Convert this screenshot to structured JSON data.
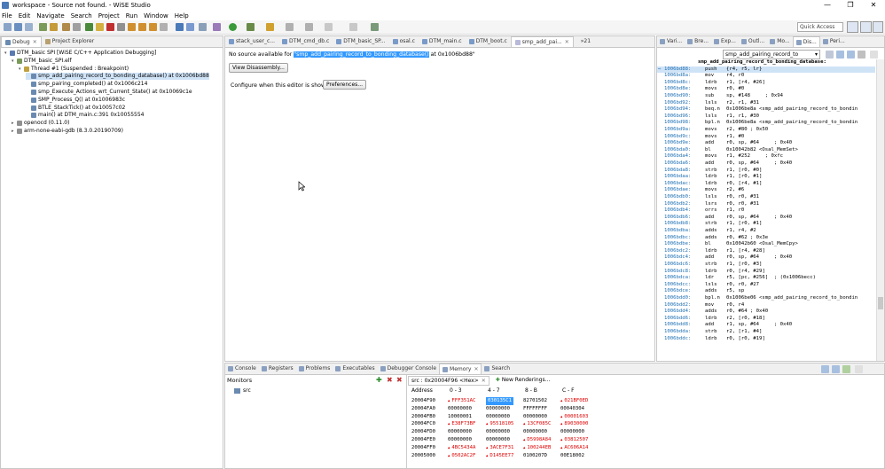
{
  "window": {
    "title": "workspace - Source not found. - WiSE Studio",
    "controls": [
      "—",
      "❐",
      "✕"
    ]
  },
  "menu": [
    "File",
    "Edit",
    "Navigate",
    "Search",
    "Project",
    "Run",
    "Window",
    "Help"
  ],
  "quick_access": {
    "placeholder": "Quick Access"
  },
  "debug_view": {
    "tabs": [
      {
        "label": "Debug",
        "active": true
      },
      {
        "label": "Project Explorer",
        "active": false
      }
    ],
    "tree": [
      {
        "label": "DTM_basic SPI [WiSE C/C++ Application Debugging]",
        "indent": 0,
        "icon": "launch-icon",
        "expanded": true,
        "selected": false
      },
      {
        "label": "DTM_basic_SPI.elf",
        "indent": 1,
        "icon": "elf-icon",
        "expanded": true,
        "selected": false
      },
      {
        "label": "Thread #1 (Suspended : Breakpoint)",
        "indent": 2,
        "icon": "thread-icon",
        "expanded": true,
        "selected": false
      },
      {
        "label": "smp_add_pairing_record_to_bonding_database() at 0x1006bd88",
        "indent": 3,
        "icon": "frame-icon",
        "expanded": false,
        "selected": true
      },
      {
        "label": "smp_pairing_completed() at 0x1006c214",
        "indent": 3,
        "icon": "frame-icon",
        "expanded": false,
        "selected": false
      },
      {
        "label": "smp_Execute_Actions_wrt_Current_State() at 0x10069c1e",
        "indent": 3,
        "icon": "frame-icon",
        "expanded": false,
        "selected": false
      },
      {
        "label": "SMP_Process_Q() at 0x1006983c",
        "indent": 3,
        "icon": "frame-icon",
        "expanded": false,
        "selected": false
      },
      {
        "label": "BTLE_StackTick() at 0x10057c02",
        "indent": 3,
        "icon": "frame-icon",
        "expanded": false,
        "selected": false
      },
      {
        "label": "main() at DTM_main.c:391 0x10055554",
        "indent": 3,
        "icon": "frame-icon",
        "expanded": false,
        "selected": false
      },
      {
        "label": "openocd (0.11.0)",
        "indent": 1,
        "icon": "process-icon",
        "expanded": false,
        "selected": false
      },
      {
        "label": "arm-none-eabi-gdb (8.3.0.20190709)",
        "indent": 1,
        "icon": "process-icon",
        "expanded": false,
        "selected": false
      }
    ]
  },
  "editor": {
    "tabs": [
      {
        "label": "stack_user_c...",
        "active": false
      },
      {
        "label": "DTM_cmd_db.c",
        "active": false
      },
      {
        "label": "DTM_basic_SP...",
        "active": false
      },
      {
        "label": "osal.c",
        "active": false
      },
      {
        "label": "DTM_main.c",
        "active": false
      },
      {
        "label": "DTM_boot.c",
        "active": false
      },
      {
        "label": "smp_add_pai...",
        "active": true
      }
    ],
    "overflow": "»21",
    "msg_prefix": "No source available for ",
    "msg_func": "\"smp_add_pairing_record_to_bonding_database()",
    "msg_suffix": " at 0x1006bd88\"",
    "view_disassembly_label": "View Disassembly...",
    "configure_text": "Configure when this editor is shown",
    "preferences_label": "Preferences..."
  },
  "right_tabs": [
    "Vari...",
    "Bre...",
    "Exp...",
    "Outl...",
    "Mo...",
    "Dis...",
    "Peri..."
  ],
  "disassembly": {
    "function_dropdown": "smp_add_pairing_record_to",
    "header": "smp_add_pairing_record_to_bonding_database:",
    "lines": [
      {
        "addr": "1006bd88:",
        "op": "push",
        "args": "{r4, r5, lr}"
      },
      {
        "addr": "1006bd8a:",
        "op": "mov",
        "args": "r4, r0"
      },
      {
        "addr": "1006bd8c:",
        "op": "ldrb",
        "args": "r1, [r4, #26]"
      },
      {
        "addr": "1006bd8e:",
        "op": "movs",
        "args": "r0, #0"
      },
      {
        "addr": "1006bd90:",
        "op": "sub",
        "args": "sp, #148     ; 0x94"
      },
      {
        "addr": "1006bd92:",
        "op": "lsls",
        "args": "r2, r1, #31"
      },
      {
        "addr": "1006bd94:",
        "op": "beq.n",
        "args": "0x1006be8a <smp_add_pairing_record_to_bondin"
      },
      {
        "addr": "1006bd96:",
        "op": "lsls",
        "args": "r1, r1, #30"
      },
      {
        "addr": "1006bd98:",
        "op": "bpl.n",
        "args": "0x1006be8a <smp_add_pairing_record_to_bondin"
      },
      {
        "addr": "1006bd9a:",
        "op": "movs",
        "args": "r2, #80 ; 0x50"
      },
      {
        "addr": "1006bd9c:",
        "op": "movs",
        "args": "r1, #0"
      },
      {
        "addr": "1006bd9e:",
        "op": "add",
        "args": "r0, sp, #64     ; 0x40"
      },
      {
        "addr": "1006bda0:",
        "op": "bl",
        "args": "0x10042b82 <Osal_MemSet>"
      },
      {
        "addr": "1006bda4:",
        "op": "movs",
        "args": "r1, #252     ; 0xfc"
      },
      {
        "addr": "1006bda6:",
        "op": "add",
        "args": "r0, sp, #64     ; 0x40"
      },
      {
        "addr": "1006bda8:",
        "op": "strb",
        "args": "r1, [r0, #0]"
      },
      {
        "addr": "1006bdaa:",
        "op": "ldrb",
        "args": "r1, [r0, #1]"
      },
      {
        "addr": "1006bdac:",
        "op": "ldrb",
        "args": "r0, [r4, #1]"
      },
      {
        "addr": "1006bdae:",
        "op": "movs",
        "args": "r2, #6"
      },
      {
        "addr": "1006bdb0:",
        "op": "lsls",
        "args": "r0, r0, #31"
      },
      {
        "addr": "1006bdb2:",
        "op": "lsrs",
        "args": "r0, r0, #31"
      },
      {
        "addr": "1006bdb4:",
        "op": "orrs",
        "args": "r1, r0"
      },
      {
        "addr": "1006bdb6:",
        "op": "add",
        "args": "r0, sp, #64     ; 0x40"
      },
      {
        "addr": "1006bdb8:",
        "op": "strb",
        "args": "r1, [r0, #1]"
      },
      {
        "addr": "1006bdba:",
        "op": "adds",
        "args": "r1, r4, #2"
      },
      {
        "addr": "1006bdbc:",
        "op": "adds",
        "args": "r0, #62 ; 0x3e"
      },
      {
        "addr": "1006bdbe:",
        "op": "bl",
        "args": "0x10042b60 <Osal_MemCpy>"
      },
      {
        "addr": "1006bdc2:",
        "op": "ldrb",
        "args": "r1, [r4, #28]"
      },
      {
        "addr": "1006bdc4:",
        "op": "add",
        "args": "r0, sp, #64     ; 0x40"
      },
      {
        "addr": "1006bdc6:",
        "op": "strb",
        "args": "r1, [r0, #3]"
      },
      {
        "addr": "1006bdc8:",
        "op": "ldrb",
        "args": "r0, [r4, #29]"
      },
      {
        "addr": "1006bdca:",
        "op": "ldr",
        "args": "r5, [pc, #256]  ; (0x1006becc)"
      },
      {
        "addr": "1006bdcc:",
        "op": "lsls",
        "args": "r0, r0, #27"
      },
      {
        "addr": "1006bdce:",
        "op": "adds",
        "args": "r5, sp"
      },
      {
        "addr": "1006bdd0:",
        "op": "bpl.n",
        "args": "0x1006be06 <smp_add_pairing_record_to_bondin"
      },
      {
        "addr": "1006bdd2:",
        "op": "mov",
        "args": "r0, r4"
      },
      {
        "addr": "1006bdd4:",
        "op": "adds",
        "args": "r0, #64 ; 0x40"
      },
      {
        "addr": "1006bdd6:",
        "op": "ldrb",
        "args": "r2, [r0, #18]"
      },
      {
        "addr": "1006bdd8:",
        "op": "add",
        "args": "r1, sp, #64     ; 0x40"
      },
      {
        "addr": "1006bdda:",
        "op": "strb",
        "args": "r2, [r1, #4]"
      },
      {
        "addr": "1006bddc:",
        "op": "ldrb",
        "args": "r0, [r0, #19]"
      }
    ]
  },
  "bottom_tabs": [
    "Console",
    "Registers",
    "Problems",
    "Executables",
    "Debugger Console",
    "Memory",
    "Search"
  ],
  "monitors": {
    "title": "Monitors",
    "items": [
      "src"
    ]
  },
  "memory": {
    "tabs": [
      "src : 0x20004F96 <Hex>",
      "New Renderings..."
    ],
    "columns": [
      "Address",
      "0 - 3",
      "4 - 7",
      "8 - B",
      "C - F"
    ],
    "rows": [
      {
        "addr": "20004F90",
        "cells": [
          {
            "v": "FFF351AC",
            "c": true
          },
          {
            "v": "030135C1",
            "sel": true
          },
          {
            "v": "82701502",
            "c": false
          },
          {
            "v": "021BF0ED",
            "c": true
          }
        ]
      },
      {
        "addr": "20004FA0",
        "cells": [
          {
            "v": "00000000",
            "c": false
          },
          {
            "v": "00000000",
            "c": false
          },
          {
            "v": "FFFFFFFF",
            "c": false
          },
          {
            "v": "00040304",
            "c": false
          }
        ]
      },
      {
        "addr": "20004FB0",
        "cells": [
          {
            "v": "10000001",
            "c": false
          },
          {
            "v": "00000000",
            "c": false
          },
          {
            "v": "00000000",
            "c": false
          },
          {
            "v": "00001603",
            "c": true
          }
        ]
      },
      {
        "addr": "20004FC0",
        "cells": [
          {
            "v": "E38F73BF",
            "c": true
          },
          {
            "v": "95518105",
            "c": true
          },
          {
            "v": "13CF085C",
            "c": true
          },
          {
            "v": "89030000",
            "c": true
          }
        ]
      },
      {
        "addr": "20004FD0",
        "cells": [
          {
            "v": "00000000",
            "c": false
          },
          {
            "v": "00000000",
            "c": false
          },
          {
            "v": "00000000",
            "c": false
          },
          {
            "v": "00000000",
            "c": false
          }
        ]
      },
      {
        "addr": "20004FE0",
        "cells": [
          {
            "v": "00000000",
            "c": false
          },
          {
            "v": "00000000",
            "c": false
          },
          {
            "v": "D5998A84",
            "c": true
          },
          {
            "v": "03812507",
            "c": true
          }
        ]
      },
      {
        "addr": "20004FF0",
        "cells": [
          {
            "v": "4BC5434A",
            "c": true
          },
          {
            "v": "3ACE7F31",
            "c": true
          },
          {
            "v": "100244EB",
            "c": true
          },
          {
            "v": "AC606A14",
            "c": true
          }
        ]
      },
      {
        "addr": "20005000",
        "cells": [
          {
            "v": "0502AC2F",
            "c": true
          },
          {
            "v": "D145EE77",
            "c": true
          },
          {
            "v": "0100207D",
            "c": false
          },
          {
            "v": "00E18002",
            "c": false
          }
        ]
      }
    ]
  },
  "colors": {
    "changed": "#e00000",
    "selection": "#3399ff",
    "highlight": "#cfe3f7",
    "address": "#1e6fb3"
  }
}
